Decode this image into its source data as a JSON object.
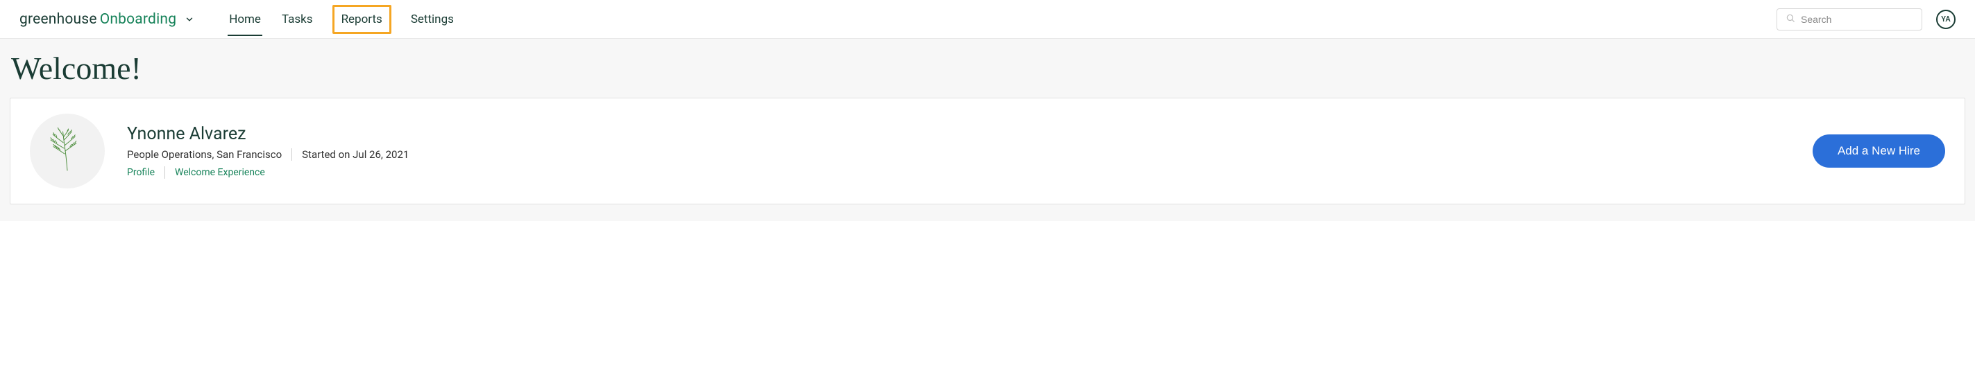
{
  "brand": {
    "part1": "greenhouse",
    "part2": "Onboarding"
  },
  "nav": {
    "home": "Home",
    "tasks": "Tasks",
    "reports": "Reports",
    "settings": "Settings"
  },
  "search": {
    "placeholder": "Search"
  },
  "user": {
    "initials": "YA"
  },
  "page": {
    "title": "Welcome!"
  },
  "profile": {
    "name": "Ynonne Alvarez",
    "role_location": "People Operations, San Francisco",
    "started": "Started on Jul 26, 2021",
    "links": {
      "profile": "Profile",
      "welcome_experience": "Welcome Experience"
    }
  },
  "actions": {
    "add_new_hire": "Add a New Hire"
  }
}
